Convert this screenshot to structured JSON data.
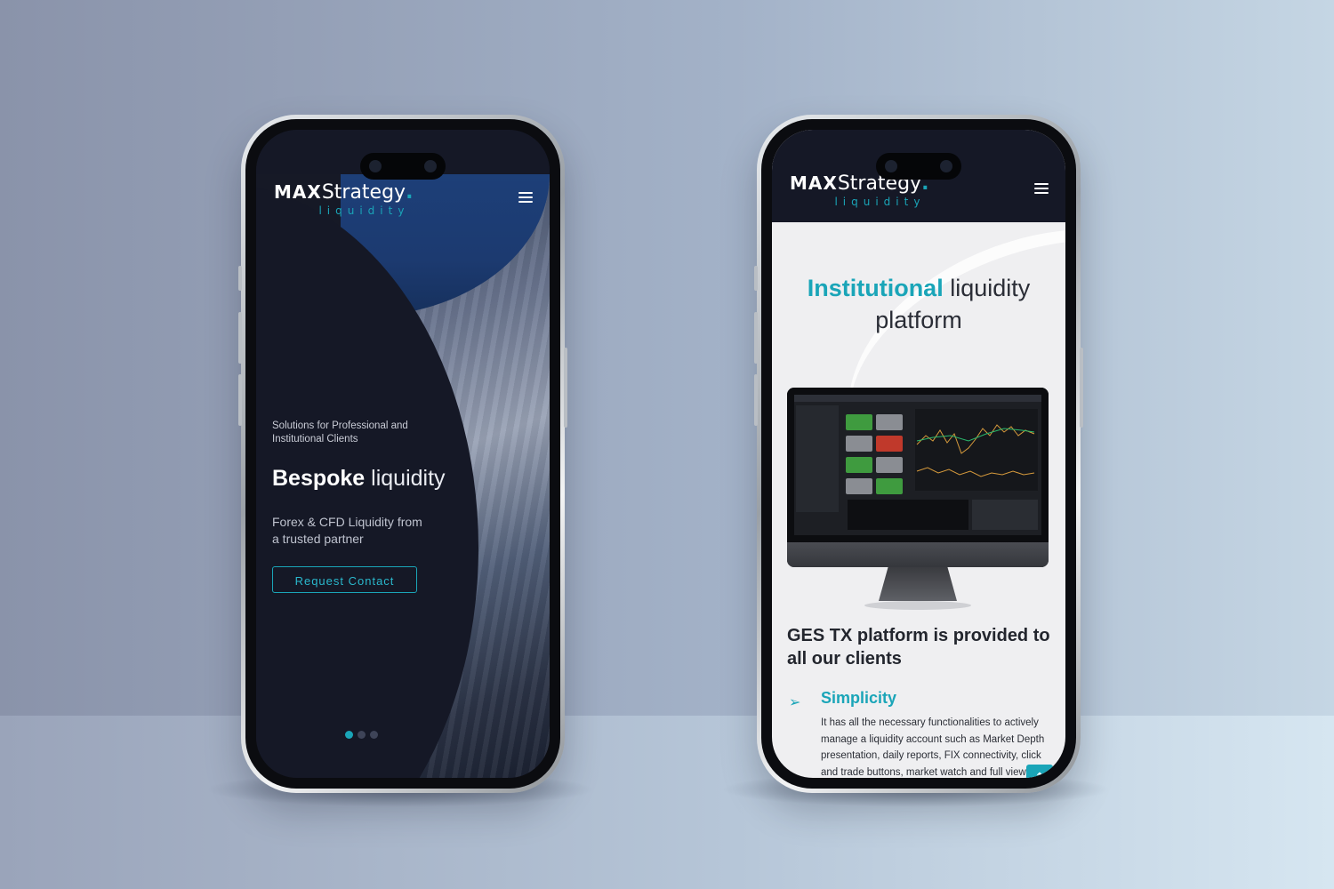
{
  "brand": {
    "logo_max": "MAX",
    "logo_strategy": "Strategy",
    "logo_dot": ".",
    "logo_sub": "liquidity",
    "accent_color": "#1aa5b8",
    "dark_bg": "#151826"
  },
  "phone1": {
    "tagline": "Solutions for Professional and Institutional Clients",
    "headline_bold": "Bespoke",
    "headline_light": "liquidity",
    "description": "Forex & CFD Liquidity from a trusted partner",
    "cta_label": "Request Contact",
    "carousel": {
      "total": 3,
      "active": 1
    },
    "menu_icon": "hamburger-icon"
  },
  "phone2": {
    "title_accent": "Institutional",
    "title_rest": "liquidity platform",
    "platform_heading": "GES TX platform is provided to all our clients",
    "feature_icon": "arrow-right-icon",
    "feature_title": "Simplicity",
    "feature_text": "It has all the necessary functionalities to actively manage a liquidity account such as Market Depth presentation, daily reports, FIX connectivity, click and trade buttons, market watch and full view",
    "scroll_top_icon": "arrow-up-icon",
    "menu_icon": "hamburger-icon"
  }
}
